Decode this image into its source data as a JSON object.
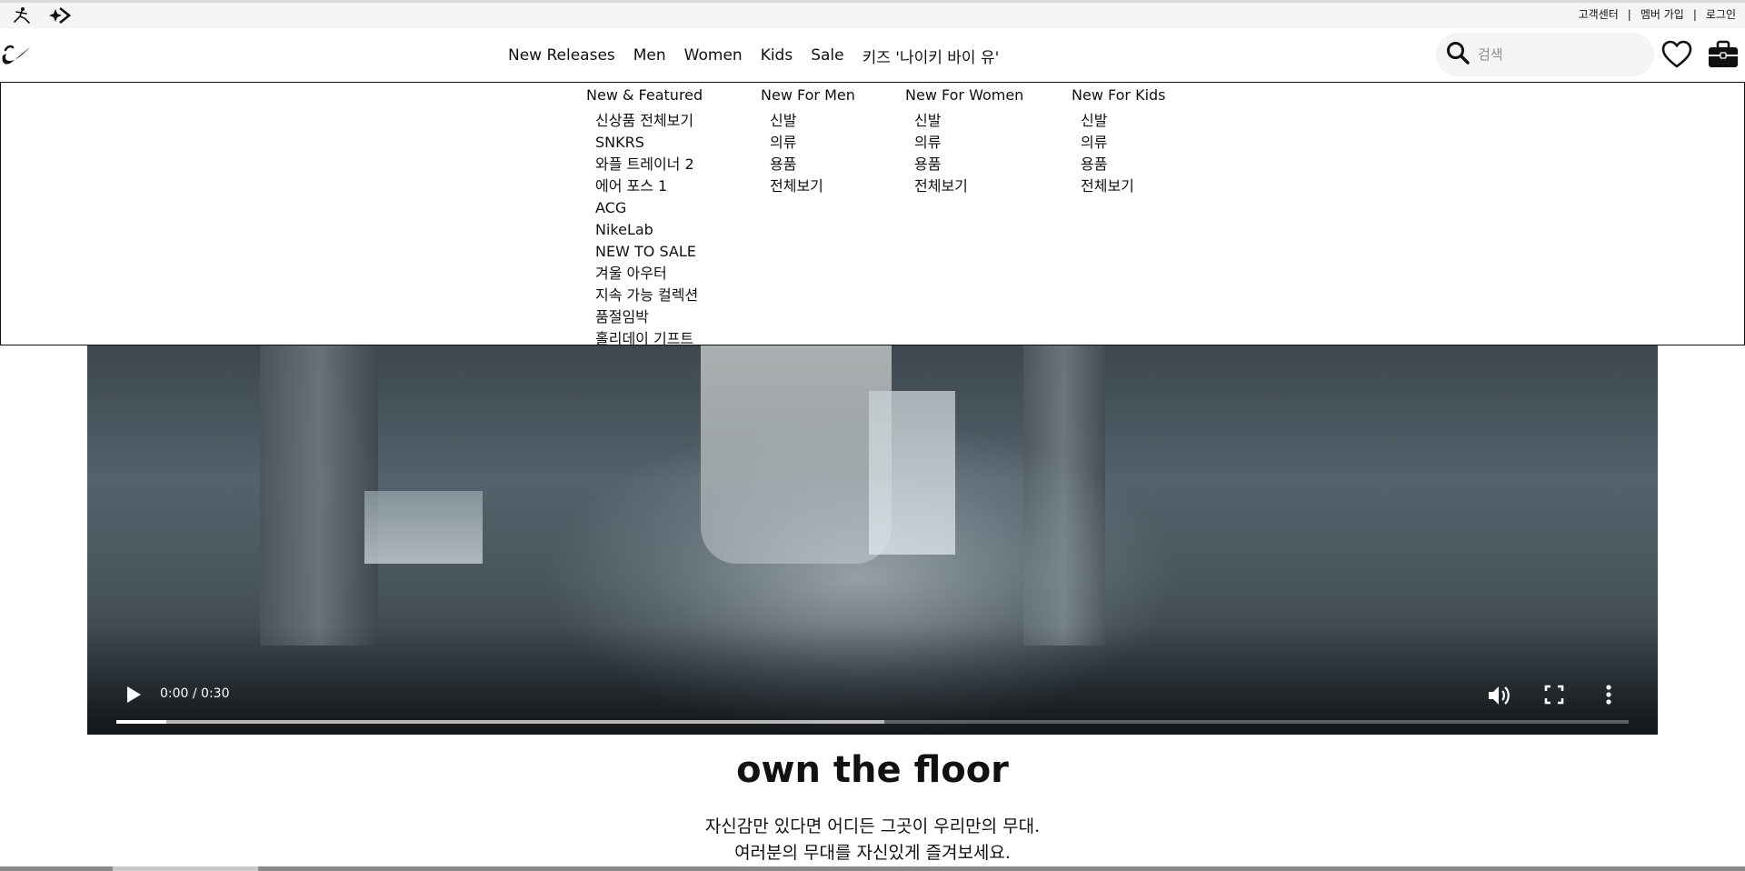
{
  "utility_bar": {
    "links": [
      "고객센터",
      "멤버 가입",
      "로그인"
    ],
    "separator": "|"
  },
  "header": {
    "nav": [
      "New Releases",
      "Men",
      "Women",
      "Kids",
      "Sale",
      "키즈 '나이키 바이 유'"
    ],
    "active_nav": "New Releases",
    "search_placeholder": "검색"
  },
  "mega_menu": {
    "columns": [
      {
        "title": "New & Featured",
        "items": [
          "신상품 전체보기",
          "SNKRS",
          "와플 트레이너 2",
          "에어 포스 1",
          "ACG",
          "NikeLab",
          "NEW TO SALE",
          "겨울 아우터",
          "지속 가능 컬렉션",
          "품절임박",
          "홀리데이 기프트"
        ]
      },
      {
        "title": "New For Men",
        "items": [
          "신발",
          "의류",
          "용품",
          "전체보기"
        ]
      },
      {
        "title": "New For Women",
        "items": [
          "신발",
          "의류",
          "용품",
          "전체보기"
        ]
      },
      {
        "title": "New For Kids",
        "items": [
          "신발",
          "의류",
          "용품",
          "전체보기"
        ]
      }
    ]
  },
  "video": {
    "time": "0:00 / 0:30",
    "played_fraction": 0.033,
    "buffered_fraction": 0.508
  },
  "content": {
    "headline": "own the floor",
    "desc_line1": "자신감만 있다면 어디든 그곳이 우리만의 무대.",
    "desc_line2": "여러분의 무대를 자신있게 즐겨보세요."
  },
  "colors": {
    "text": "#111111",
    "utility_bg": "#f5f5f5",
    "search_bg": "#f5f5f5"
  }
}
